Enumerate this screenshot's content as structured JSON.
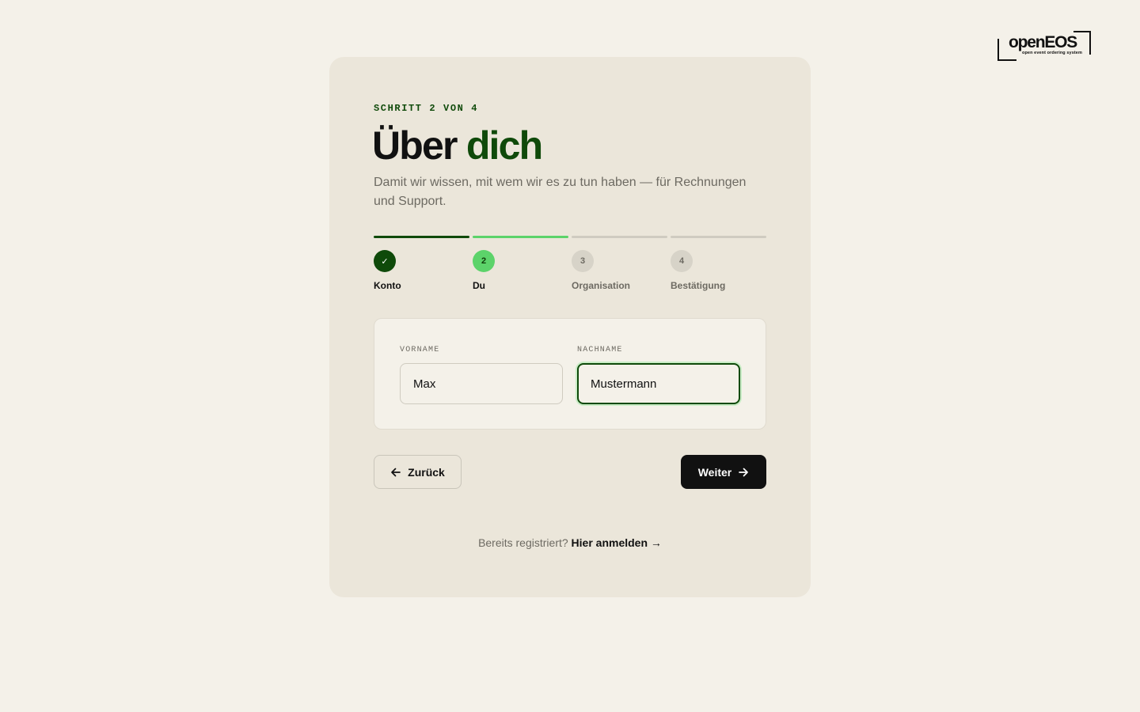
{
  "brand": {
    "name": "openEOS",
    "tagline": "open event ordering system"
  },
  "card": {
    "step_label": "SCHRITT 2 VON 4",
    "title_main": "Über",
    "title_accent": "dich",
    "subtitle": "Damit wir wissen, mit wem wir es zu tun haben — für Rechnungen und Support."
  },
  "stepper": {
    "steps": [
      {
        "label": "Konto",
        "marker": "✓",
        "state": "done"
      },
      {
        "label": "Du",
        "marker": "2",
        "state": "active"
      },
      {
        "label": "Organisation",
        "marker": "3",
        "state": "pending"
      },
      {
        "label": "Bestätigung",
        "marker": "4",
        "state": "pending"
      }
    ]
  },
  "form": {
    "first_name": {
      "label": "VORNAME",
      "value": "Max"
    },
    "last_name": {
      "label": "NACHNAME",
      "value": "Mustermann"
    }
  },
  "actions": {
    "back_label": "Zurück",
    "next_label": "Weiter"
  },
  "footer": {
    "prompt": "Bereits registriert?",
    "link_label": "Hier anmelden",
    "link_arrow": "→"
  },
  "colors": {
    "background": "#f4f1e9",
    "card": "#ebe6da",
    "accent_dark": "#0f4a0a",
    "accent_light": "#5cd36a"
  }
}
